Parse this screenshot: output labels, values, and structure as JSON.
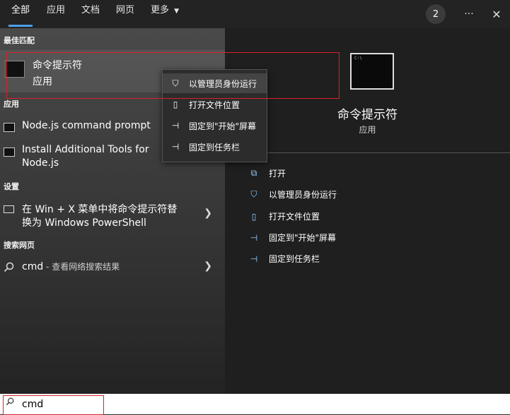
{
  "tabs": [
    {
      "label": "全部"
    },
    {
      "label": "应用"
    },
    {
      "label": "文档"
    },
    {
      "label": "网页"
    },
    {
      "label": "更多"
    }
  ],
  "header": {
    "badge_count": "2",
    "more_glyph": "···",
    "close_glyph": "✕"
  },
  "left": {
    "best_match_heading": "最佳匹配",
    "best_match": {
      "title": "命令提示符",
      "subtitle": "应用"
    },
    "apps_heading": "应用",
    "apps": [
      {
        "label": "Node.js command prompt"
      },
      {
        "label": "Install Additional Tools for Node.js",
        "line1": "Install Additional Tools for",
        "line2": "Node.js"
      }
    ],
    "settings_heading": "设置",
    "settings_item": {
      "line1": "在 Win + X 菜单中将命令提示符替",
      "line2": "换为 Windows PowerShell"
    },
    "web_heading": "搜索网页",
    "web_item": {
      "query": "cmd",
      "suffix": " - 查看网络搜索结果"
    }
  },
  "context_menu": [
    {
      "label": "以管理员身份运行",
      "icon": "shield-icon"
    },
    {
      "label": "打开文件位置",
      "icon": "file-location-icon"
    },
    {
      "label": "固定到\"开始\"屏幕",
      "icon": "pin-icon"
    },
    {
      "label": "固定到任务栏",
      "icon": "pin-icon"
    }
  ],
  "right": {
    "title": "命令提示符",
    "subtitle": "应用",
    "actions": [
      {
        "label": "打开",
        "icon": "open-icon"
      },
      {
        "label": "以管理员身份运行",
        "icon": "shield-icon"
      },
      {
        "label": "打开文件位置",
        "icon": "file-location-icon"
      },
      {
        "label": "固定到\"开始\"屏幕",
        "icon": "pin-icon"
      },
      {
        "label": "固定到任务栏",
        "icon": "pin-icon"
      }
    ]
  },
  "search": {
    "value": "cmd"
  },
  "colors": {
    "accent": "#4c9fe6",
    "highlight_box": "#d6212d"
  }
}
